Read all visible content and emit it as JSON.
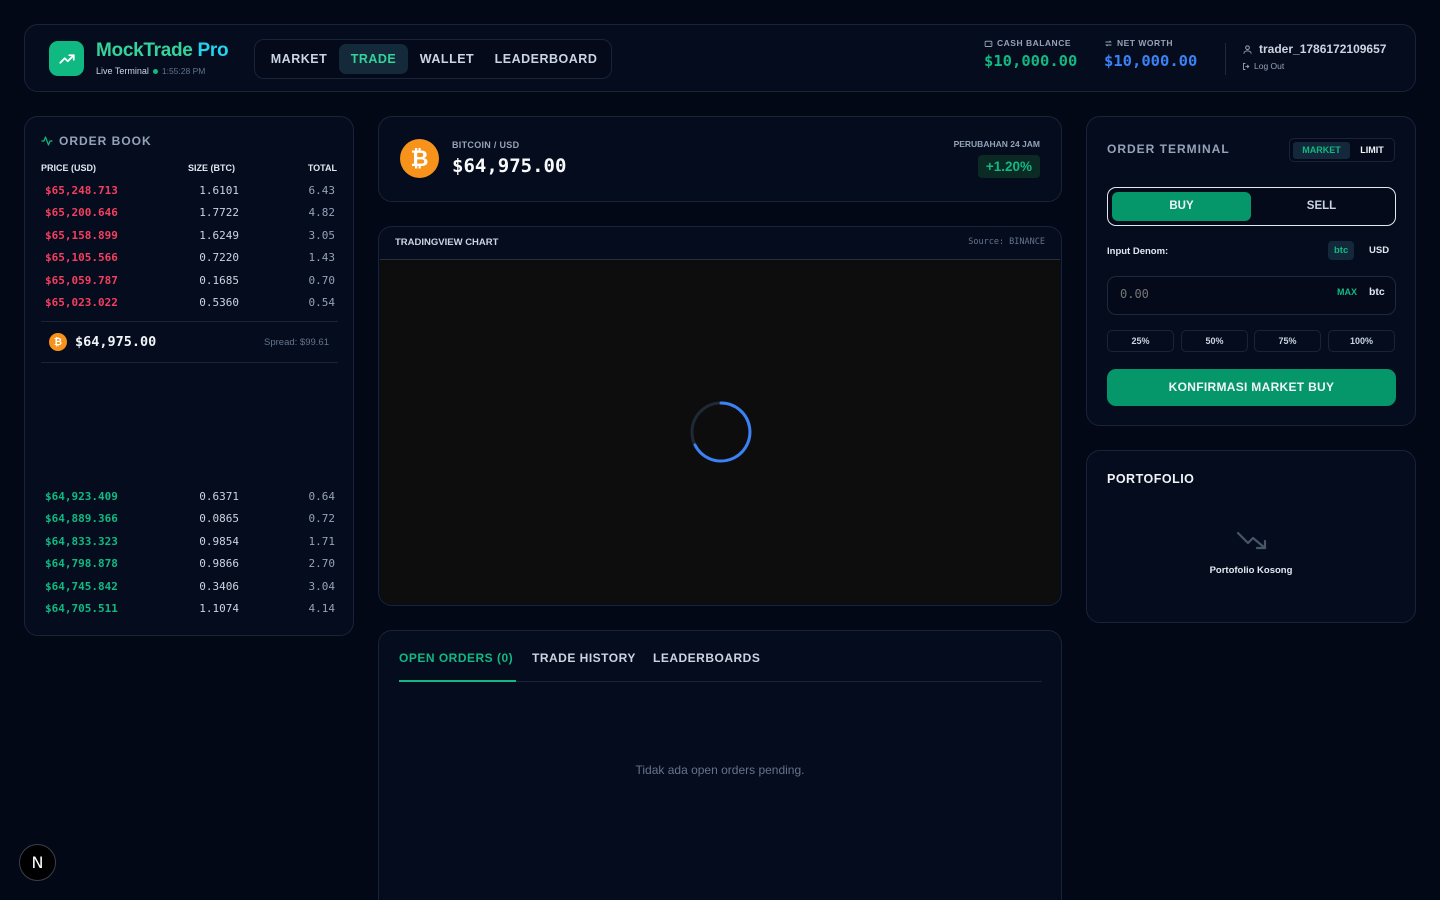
{
  "header": {
    "brand_main": "MockTrade",
    "brand_suffix": " Pro",
    "live_label": "Live Terminal",
    "time": "1:55:28 PM",
    "nav": [
      {
        "label": "MARKET",
        "active": false
      },
      {
        "label": "TRADE",
        "active": true
      },
      {
        "label": "WALLET",
        "active": false
      },
      {
        "label": "LEADERBOARD",
        "active": false
      }
    ],
    "cash_label": "CASH BALANCE",
    "cash_value": "$10,000.00",
    "net_label": "NET WORTH",
    "net_value": "$10,000.00",
    "username": "trader_1786172109657",
    "logout": "Log Out"
  },
  "orderbook": {
    "title": "ORDER BOOK",
    "col_price": "PRICE (USD)",
    "col_size": "SIZE (BTC)",
    "col_total": "TOTAL",
    "asks": [
      {
        "price": "$65,248.713",
        "size": "1.6101",
        "total": "6.43"
      },
      {
        "price": "$65,200.646",
        "size": "1.7722",
        "total": "4.82"
      },
      {
        "price": "$65,158.899",
        "size": "1.6249",
        "total": "3.05"
      },
      {
        "price": "$65,105.566",
        "size": "0.7220",
        "total": "1.43"
      },
      {
        "price": "$65,059.787",
        "size": "0.1685",
        "total": "0.70"
      },
      {
        "price": "$65,023.022",
        "size": "0.5360",
        "total": "0.54"
      }
    ],
    "mid_price": "$64,975.00",
    "spread": "Spread: $99.61",
    "bids": [
      {
        "price": "$64,923.409",
        "size": "0.6371",
        "total": "0.64"
      },
      {
        "price": "$64,889.366",
        "size": "0.0865",
        "total": "0.72"
      },
      {
        "price": "$64,833.323",
        "size": "0.9854",
        "total": "1.71"
      },
      {
        "price": "$64,798.878",
        "size": "0.9866",
        "total": "2.70"
      },
      {
        "price": "$64,745.842",
        "size": "0.3406",
        "total": "3.04"
      },
      {
        "price": "$64,705.511",
        "size": "1.1074",
        "total": "4.14"
      }
    ]
  },
  "ticker": {
    "pair": "BITCOIN / USD",
    "price": "$64,975.00",
    "change_label": "PERUBAHAN 24 JAM",
    "change_value": "+1.20%"
  },
  "chart": {
    "title": "TRADINGVIEW CHART",
    "source": "Source: BINANCE"
  },
  "orders": {
    "tabs": [
      {
        "label": "OPEN ORDERS (0)",
        "active": true
      },
      {
        "label": "TRADE HISTORY",
        "active": false
      },
      {
        "label": "LEADERBOARDS",
        "active": false
      }
    ],
    "empty": "Tidak ada open orders pending."
  },
  "terminal": {
    "title": "ORDER TERMINAL",
    "mode_market": "MARKET",
    "mode_limit": "LIMIT",
    "buy": "BUY",
    "sell": "SELL",
    "denom_label": "Input Denom:",
    "denom_btc": "btc",
    "denom_usd": "USD",
    "amount_placeholder": "0.00",
    "max": "MAX",
    "unit": "btc",
    "pcts": [
      "25%",
      "50%",
      "75%",
      "100%"
    ],
    "confirm": "KONFIRMASI MARKET BUY"
  },
  "portfolio": {
    "title": "PORTOFOLIO",
    "empty": "Portofolio Kosong"
  },
  "colors": {
    "accent_green": "#10b981",
    "ask_red": "#f43f5e",
    "bitcoin_orange": "#f7931a",
    "net_worth_blue": "#3b82f6"
  },
  "icons": [
    "trending-up-icon",
    "wallet-icon",
    "swap-icon",
    "user-icon",
    "logout-icon",
    "activity-icon",
    "bitcoin-icon",
    "loading-spinner-icon",
    "trending-down-icon"
  ]
}
